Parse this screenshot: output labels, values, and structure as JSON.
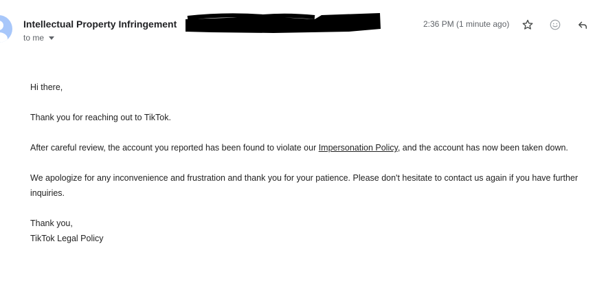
{
  "email": {
    "subject": "Intellectual Property Infringement",
    "recipient": "to me",
    "time": "2:36 PM (1 minute ago)",
    "body": {
      "greeting": "Hi there,",
      "p1": "Thank you for reaching out to TikTok.",
      "p2_before": "After careful review, the account you reported has been found to violate our ",
      "p2_link": "Impersonation Policy",
      "p2_after": ", and the account has now been taken down.",
      "p3": "We apologize for any inconvenience and frustration and thank you for your patience. Please don't hesitate to contact us again if you have further inquiries.",
      "signoff": "Thank you,",
      "signature": "TikTok Legal Policy"
    }
  },
  "icons": {
    "star": "star-icon",
    "emoji": "emoji-icon",
    "reply": "reply-icon",
    "avatar": "avatar-icon",
    "recipient_dropdown": "chevron-down-icon"
  },
  "colors": {
    "avatar_bg": "#a8c7fa",
    "text": "#222222",
    "muted": "#5f6368",
    "redaction": "#000000"
  }
}
